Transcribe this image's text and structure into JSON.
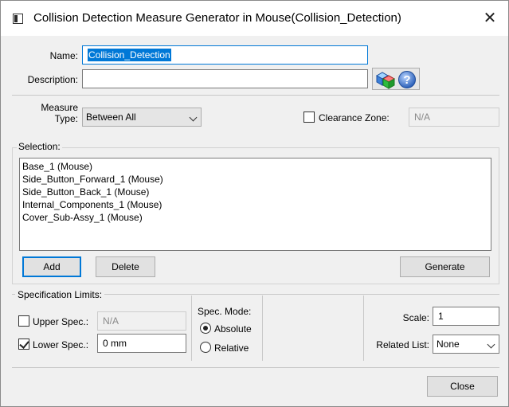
{
  "window": {
    "title": "Collision Detection Measure Generator in Mouse(Collision_Detection)",
    "close_glyph": "✕"
  },
  "name": {
    "label": "Name:",
    "value": "Collision_Detection"
  },
  "description": {
    "label": "Description:",
    "value": ""
  },
  "measure_type": {
    "label_line1": "Measure",
    "label_line2": "Type:",
    "value": "Between All"
  },
  "clearance_zone": {
    "label": "Clearance Zone:",
    "value": "N/A",
    "checked": false
  },
  "selection": {
    "label": "Selection:",
    "items": [
      "Base_1 (Mouse)",
      "Side_Button_Forward_1 (Mouse)",
      "Side_Button_Back_1 (Mouse)",
      "Internal_Components_1 (Mouse)",
      "Cover_Sub-Assy_1 (Mouse)"
    ],
    "add_label": "Add",
    "delete_label": "Delete",
    "generate_label": "Generate"
  },
  "spec_limits": {
    "label": "Specification Limits:",
    "upper_label": "Upper Spec.:",
    "upper_value": "N/A",
    "upper_checked": false,
    "lower_label": "Lower Spec.:",
    "lower_value": "0 mm",
    "lower_checked": true
  },
  "spec_mode": {
    "label": "Spec. Mode:",
    "absolute_label": "Absolute",
    "relative_label": "Relative",
    "selected": "Absolute"
  },
  "scale": {
    "label": "Scale:",
    "value": "1"
  },
  "related_list": {
    "label": "Related List:",
    "value": "None"
  },
  "footer": {
    "close_label": "Close"
  },
  "icons": {
    "title_icon": "window-app-icon",
    "select_icon": "select-geometry-icon",
    "help_icon": "help-icon"
  },
  "colors": {
    "accent": "#0078d7",
    "help_blue": "#3a73c8"
  }
}
